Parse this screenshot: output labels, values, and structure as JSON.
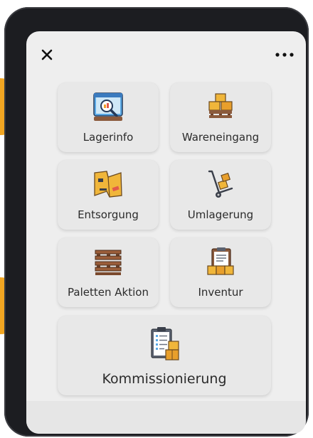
{
  "menu": {
    "close_icon": "close-icon",
    "more_icon": "more-icon",
    "tiles": [
      {
        "label": "Lagerinfo",
        "icon": "warehouse-search-icon"
      },
      {
        "label": "Wareneingang",
        "icon": "boxes-on-pallet-icon"
      },
      {
        "label": "Entsorgung",
        "icon": "damaged-box-icon"
      },
      {
        "label": "Umlagerung",
        "icon": "hand-truck-icon"
      },
      {
        "label": "Paletten Aktion",
        "icon": "pallets-icon"
      },
      {
        "label": "Inventur",
        "icon": "clipboard-boxes-icon"
      },
      {
        "label": "Kommissionierung",
        "icon": "picking-list-icon"
      }
    ]
  },
  "colors": {
    "accent": "#f1a622",
    "tile_bg": "#e8e8e8",
    "screen_bg": "#eeeeee",
    "frame": "#1c1d21"
  }
}
